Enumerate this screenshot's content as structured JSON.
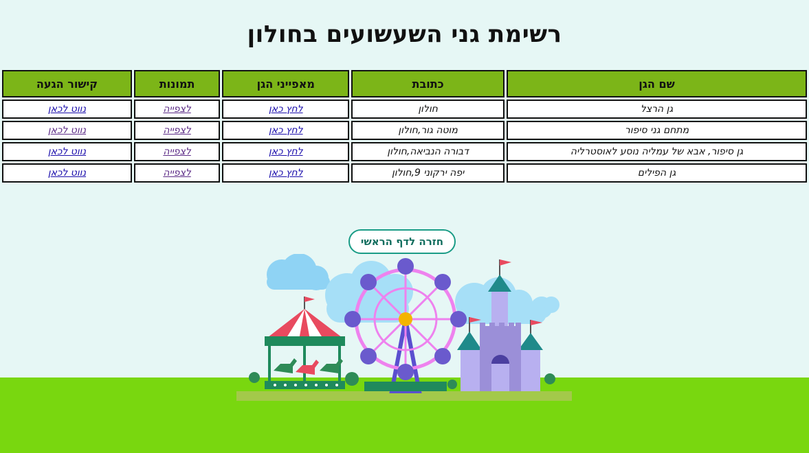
{
  "page": {
    "title": "רשימת גני השעשועים בחולון"
  },
  "table": {
    "headers": {
      "name": "שם הגן",
      "address": "כתובת",
      "features": "מאפייני הגן",
      "pictures": "תמונות",
      "navigation": "קישור הגעה"
    },
    "rows": [
      {
        "name": "גן הרצל",
        "address": "חולון",
        "features": "לחץ כאן",
        "pictures": "לצפייה",
        "navigation": "נווט לכאן"
      },
      {
        "name": "מתחם גני סיפור",
        "address": "מוטה גור,חולון",
        "features": "לחץ כאן",
        "pictures": "לצפייה",
        "navigation": "נווט לכאן"
      },
      {
        "name": "גן סיפור, אבא של עמליה נוסע לאוסטרליה",
        "address": "דבורה הנביאה,חולון",
        "features": "לחץ כאן",
        "pictures": "לצפייה",
        "navigation": "נווט לכאן"
      },
      {
        "name": "גן הפילים",
        "address": "יפה ירקוני 9,חולון",
        "features": "לחץ כאן",
        "pictures": "לצפייה",
        "navigation": "נווט לכאן"
      }
    ]
  },
  "back_button": {
    "label": "חזרה לדף הראשי"
  },
  "colors": {
    "background": "#e6f7f5",
    "header_green": "#7cb518",
    "grass_green": "#79d70f",
    "button_teal": "#1a9c86",
    "link_blue": "#1a0dab",
    "link_visited": "#5b2a86"
  },
  "illustration": {
    "icons": [
      "carousel-icon",
      "ferris-wheel-icon",
      "castle-icon",
      "cloud-icon"
    ]
  }
}
